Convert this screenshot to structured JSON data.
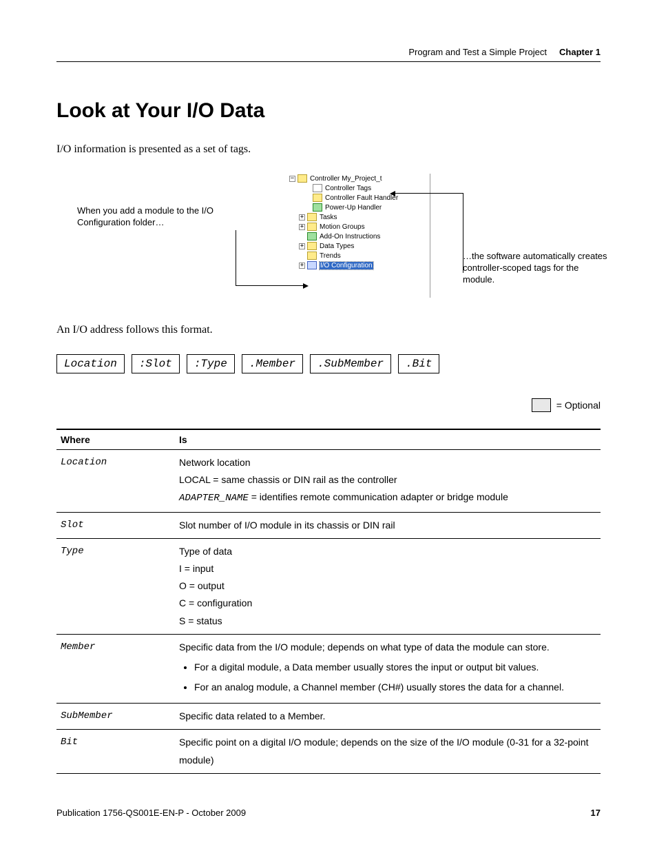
{
  "header": {
    "doc_title": "Program and Test a Simple Project",
    "chapter": "Chapter 1"
  },
  "h1": "Look at Your I/O Data",
  "intro": "I/O information is presented as a set of tags.",
  "diagram": {
    "left_caption": "When you add a module to the I/O Configuration folder…",
    "right_caption": "…the software automatically creates controller-scoped tags for the module.",
    "tree": {
      "root": "Controller My_Project_t",
      "items": [
        "Controller Tags",
        "Controller Fault Handler",
        "Power-Up Handler"
      ],
      "branches": [
        "Tasks",
        "Motion Groups",
        "Add-On Instructions",
        "Data Types",
        "Trends",
        "I/O Configuration"
      ]
    }
  },
  "format_intro": "An I/O address follows this format.",
  "format_parts": [
    "Location",
    ":Slot",
    ":Type",
    ".Member",
    ".SubMember",
    ".Bit"
  ],
  "optional_label": "= Optional",
  "table": {
    "headers": [
      "Where",
      "Is"
    ],
    "rows": [
      {
        "where": "Location",
        "is": "Network location",
        "extras": [
          "LOCAL = same chassis or DIN rail as the controller",
          "ADAPTER_NAME = identifies remote communication adapter or bridge module"
        ],
        "extras_mono_idx": 1
      },
      {
        "where": "Slot",
        "is": "Slot number of I/O module in its chassis or DIN rail"
      },
      {
        "where": "Type",
        "is": "Type of data",
        "extras": [
          "I = input",
          "O = output",
          "C = configuration",
          "S = status"
        ]
      },
      {
        "where": "Member",
        "is": "Specific data from the I/O module; depends on what type of data the module can store.",
        "bullets": [
          "For a digital module, a Data member usually stores the input or output bit values.",
          "For an analog module, a Channel member (CH#) usually stores the data for a channel."
        ]
      },
      {
        "where": "SubMember",
        "is": "Specific data related to a Member."
      },
      {
        "where": "Bit",
        "is": "Specific point on a digital I/O module; depends on the size of the I/O module (0-31 for a 32-point module)"
      }
    ]
  },
  "footer": {
    "pub": "Publication 1756-QS001E-EN-P - October 2009",
    "page": "17"
  }
}
